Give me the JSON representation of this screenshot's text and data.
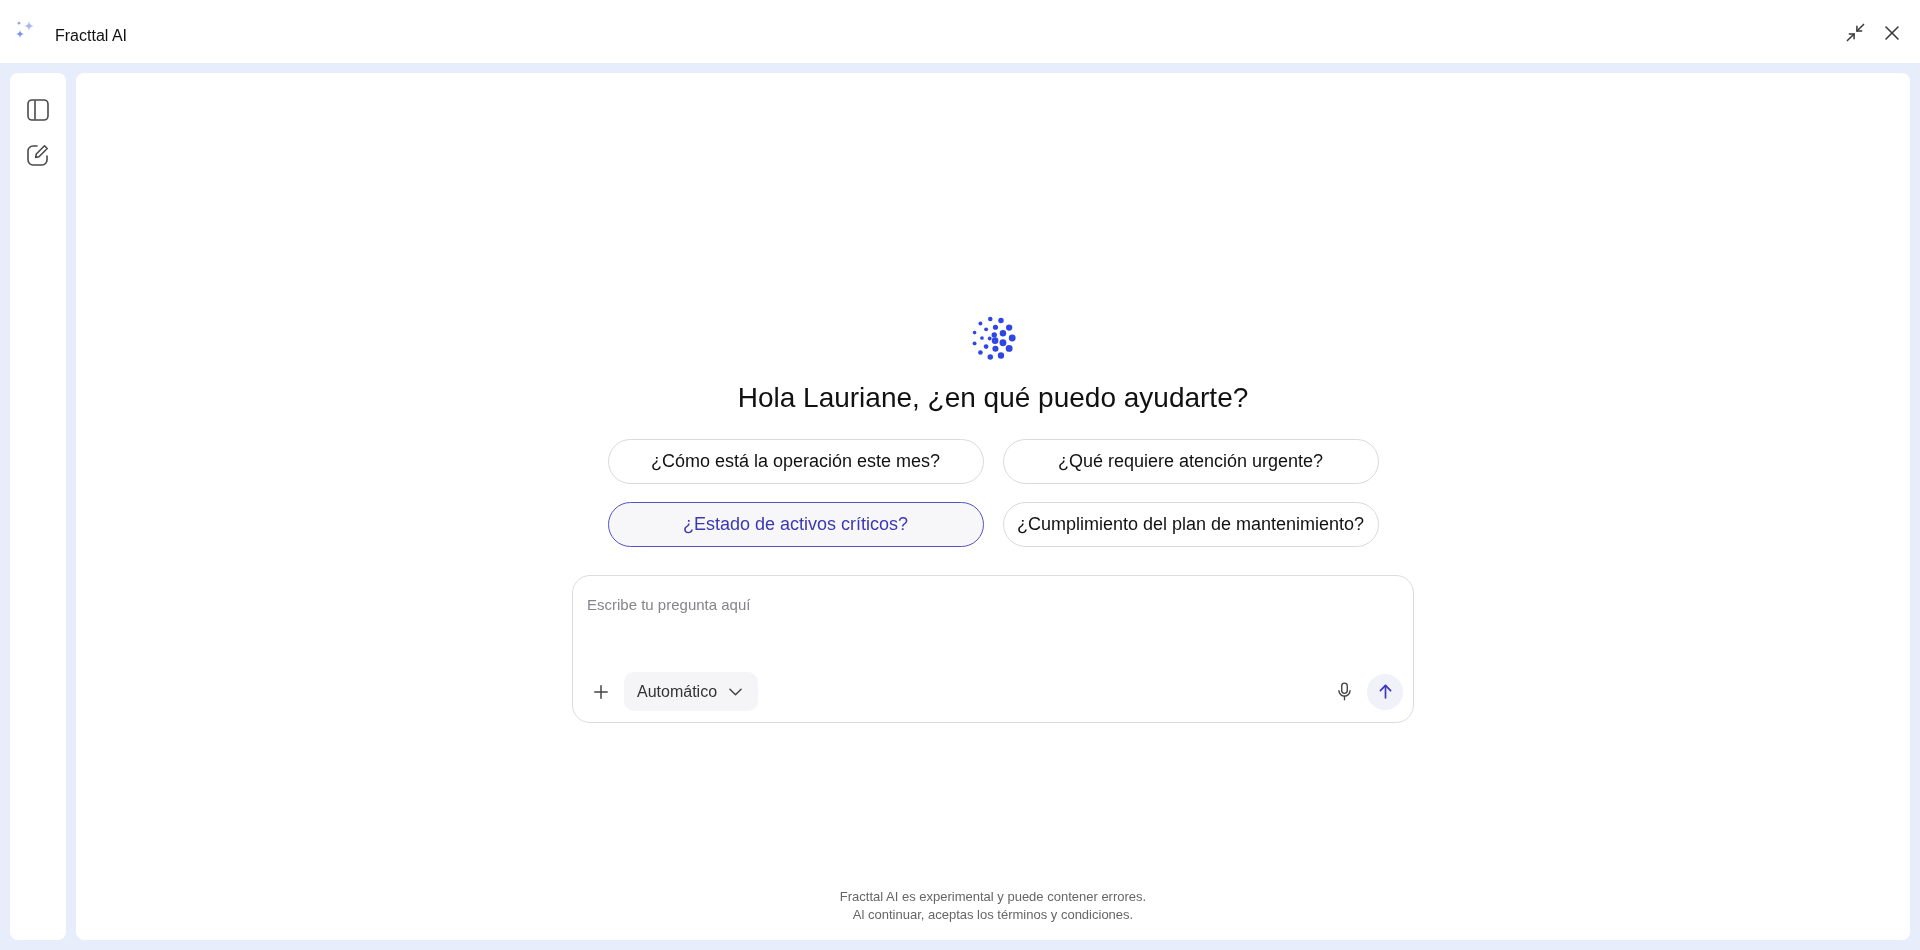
{
  "header": {
    "title": "Fracttal AI"
  },
  "greeting": "Hola Lauriane, ¿en qué puedo ayudarte?",
  "suggestions": [
    {
      "label": "¿Cómo está la operación este mes?",
      "selected": false
    },
    {
      "label": "¿Qué requiere atención urgente?",
      "selected": false
    },
    {
      "label": "¿Estado de activos críticos?",
      "selected": true
    },
    {
      "label": "¿Cumplimiento del plan de mantenimiento?",
      "selected": false
    }
  ],
  "composer": {
    "placeholder": "Escribe tu pregunta aquí",
    "model": "Automático"
  },
  "disclaimer": [
    "Fracttal AI es experimental y puede contener errores.",
    "Al continuar, aceptas los términos y condiciones."
  ]
}
